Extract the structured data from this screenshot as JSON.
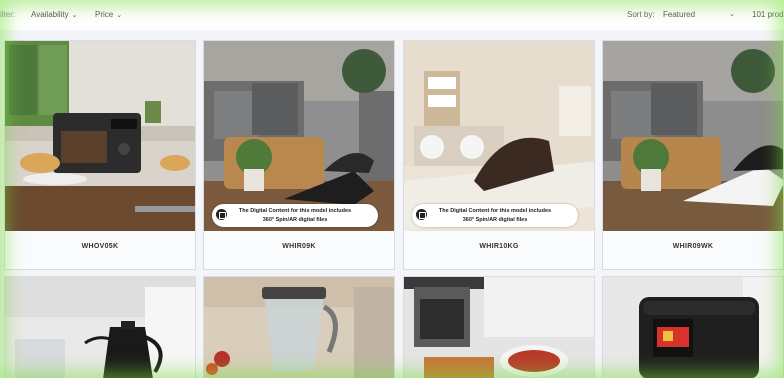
{
  "filter": {
    "label": "ilter:",
    "availability": "Availability",
    "price": "Price"
  },
  "sort": {
    "label": "Sort by:",
    "value": "Featured"
  },
  "product_count": "101 produ",
  "badge_text": {
    "line1": "The Digital Content for this model includes",
    "line2": "360° Spin/AR digital files"
  },
  "products": [
    {
      "title": "WHOV05K"
    },
    {
      "title": "WHIR09K"
    },
    {
      "title": "WHIR10KG"
    },
    {
      "title": "WHIR09WK"
    }
  ],
  "icons": [
    "chevron-down-icon",
    "ar-cube-icon"
  ]
}
